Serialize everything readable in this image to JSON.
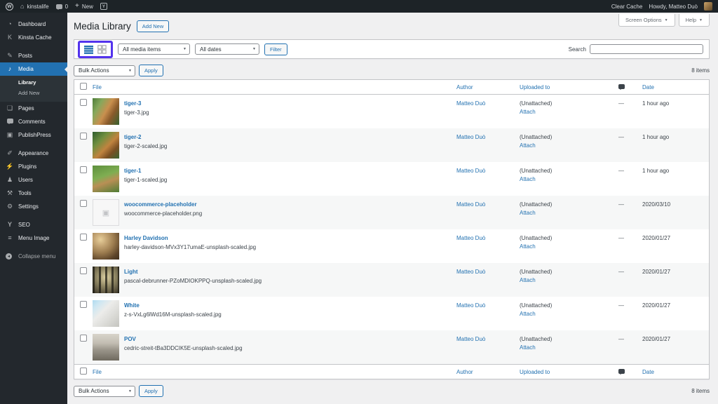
{
  "admin_bar": {
    "site_name": "kinstalife",
    "comment_count": "0",
    "new_label": "New",
    "clear_cache_label": "Clear Cache",
    "howdy": "Howdy, Matteo Duò",
    "wp_logo_letter": "W",
    "yoast_letter": "Y",
    "home_glyph": "⌂",
    "plus_glyph": "+"
  },
  "sidebar": {
    "items": [
      {
        "label": "Dashboard",
        "glyph": "◔"
      },
      {
        "label": "Kinsta Cache",
        "glyph": "K"
      },
      {
        "label": "Posts",
        "glyph": "✎"
      },
      {
        "label": "Media",
        "glyph": "♪"
      },
      {
        "label": "Pages",
        "glyph": "❏"
      },
      {
        "label": "Comments"
      },
      {
        "label": "PublishPress",
        "glyph": "▣"
      },
      {
        "label": "Appearance",
        "glyph": "✐"
      },
      {
        "label": "Plugins",
        "glyph": "⚡"
      },
      {
        "label": "Users",
        "glyph": "♟"
      },
      {
        "label": "Tools",
        "glyph": "⚒"
      },
      {
        "label": "Settings",
        "glyph": "⚙"
      },
      {
        "label": "SEO",
        "glyph": "Y"
      },
      {
        "label": "Menu Image",
        "glyph": "≡"
      },
      {
        "label": "Collapse menu",
        "glyph": "◂"
      }
    ],
    "submenu": [
      {
        "label": "Library"
      },
      {
        "label": "Add New"
      }
    ]
  },
  "header": {
    "title": "Media Library",
    "add_new_label": "Add New",
    "screen_options_label": "Screen Options",
    "help_label": "Help",
    "caret": "▼"
  },
  "filters": {
    "media_dropdown_value": "All media items",
    "dates_dropdown_value": "All dates",
    "filter_button_label": "Filter",
    "search_label": "Search",
    "search_value": "",
    "chevron": "▼"
  },
  "bulk": {
    "dropdown_value": "Bulk Actions",
    "apply_label": "Apply",
    "item_count": "8 items"
  },
  "annotation": {
    "highlight_color": "#5333ed"
  },
  "colors": {
    "accent_blue": "#2271b1",
    "active_menu": "#2271b1"
  },
  "table": {
    "columns": {
      "file": "File",
      "author": "Author",
      "uploaded": "Uploaded to",
      "date": "Date"
    },
    "rows": [
      {
        "title": "tiger-3",
        "filename": "tiger-3.jpg",
        "author": "Matteo Duò",
        "uploaded_status": "(Unattached)",
        "attach_label": "Attach",
        "comments": "—",
        "date": "1 hour ago",
        "thumb_style": "background:linear-gradient(120deg,#4e7d3a 0%,#86a85c 25%,#c98f4e 50%,#8a5a2b 70%,#35602f 100%)"
      },
      {
        "title": "tiger-2",
        "filename": "tiger-2-scaled.jpg",
        "author": "Matteo Duò",
        "uploaded_status": "(Unattached)",
        "attach_label": "Attach",
        "comments": "—",
        "date": "1 hour ago",
        "thumb_style": "background:linear-gradient(135deg,#2e5c2e 0%,#6f8f3f 30%,#c0833f 55%,#7a4f23 75%,#3a6330 100%)"
      },
      {
        "title": "tiger-1",
        "filename": "tiger-1-scaled.jpg",
        "author": "Matteo Duò",
        "uploaded_status": "(Unattached)",
        "attach_label": "Attach",
        "comments": "—",
        "date": "1 hour ago",
        "thumb_style": "background:linear-gradient(160deg,#5d8f3c 0%,#7fae52 40%,#b98f55 60%,#4e7d35 100%)"
      },
      {
        "title": "woocommerce-placeholder",
        "filename": "woocommerce-placeholder.png",
        "author": "Matteo Duò",
        "uploaded_status": "(Unattached)",
        "attach_label": "Attach",
        "comments": "—",
        "date": "2020/03/10",
        "thumb_style": "background:#f7f7f7;border:1px solid #dcdcde",
        "thumb_icon": "▣"
      },
      {
        "title": "Harley Davidson",
        "filename": "harley-davidson-MVx3Y17umaE-unsplash-scaled.jpg",
        "author": "Matteo Duò",
        "uploaded_status": "(Unattached)",
        "attach_label": "Attach",
        "comments": "—",
        "date": "2020/01/27",
        "thumb_style": "background:radial-gradient(circle at 30% 25%,#e7cf9a 0%,#c7a877 22%,#9b7b4e 50%,#5e452a 78%,#3f2f1d 100%)"
      },
      {
        "title": "Light",
        "filename": "pascal-debrunner-PZoMDIOKPPQ-unsplash-scaled.jpg",
        "author": "Matteo Duò",
        "uploaded_status": "(Unattached)",
        "attach_label": "Attach",
        "comments": "—",
        "date": "2020/01/27",
        "thumb_style": "background:repeating-linear-gradient(90deg,rgba(30,28,20,0.75) 0 3px,rgba(0,0,0,0) 3px 9px),radial-gradient(circle at 50% 40%,#dfd3a5 0%,#8f8663 45%,#57503c 80%,#332e22 100%)"
      },
      {
        "title": "White",
        "filename": "z-s-VxLg6lWd16M-unsplash-scaled.jpg",
        "author": "Matteo Duò",
        "uploaded_status": "(Unattached)",
        "attach_label": "Attach",
        "comments": "—",
        "date": "2020/01/27",
        "thumb_style": "background:linear-gradient(135deg,#aedaf0 0%,#cfe7f2 18%,#ececea 40%,#d9d9d5 70%,#c4c4bf 100%)"
      },
      {
        "title": "POV",
        "filename": "cedric-streit-tBa3DDCIK5E-unsplash-scaled.jpg",
        "author": "Matteo Duò",
        "uploaded_status": "(Unattached)",
        "attach_label": "Attach",
        "comments": "—",
        "date": "2020/01/27",
        "thumb_style": "background:linear-gradient(180deg,#d8d4cb 0%,#c2bdb2 35%,#9a958a 60%,#6f6a5f 100%)"
      }
    ]
  }
}
